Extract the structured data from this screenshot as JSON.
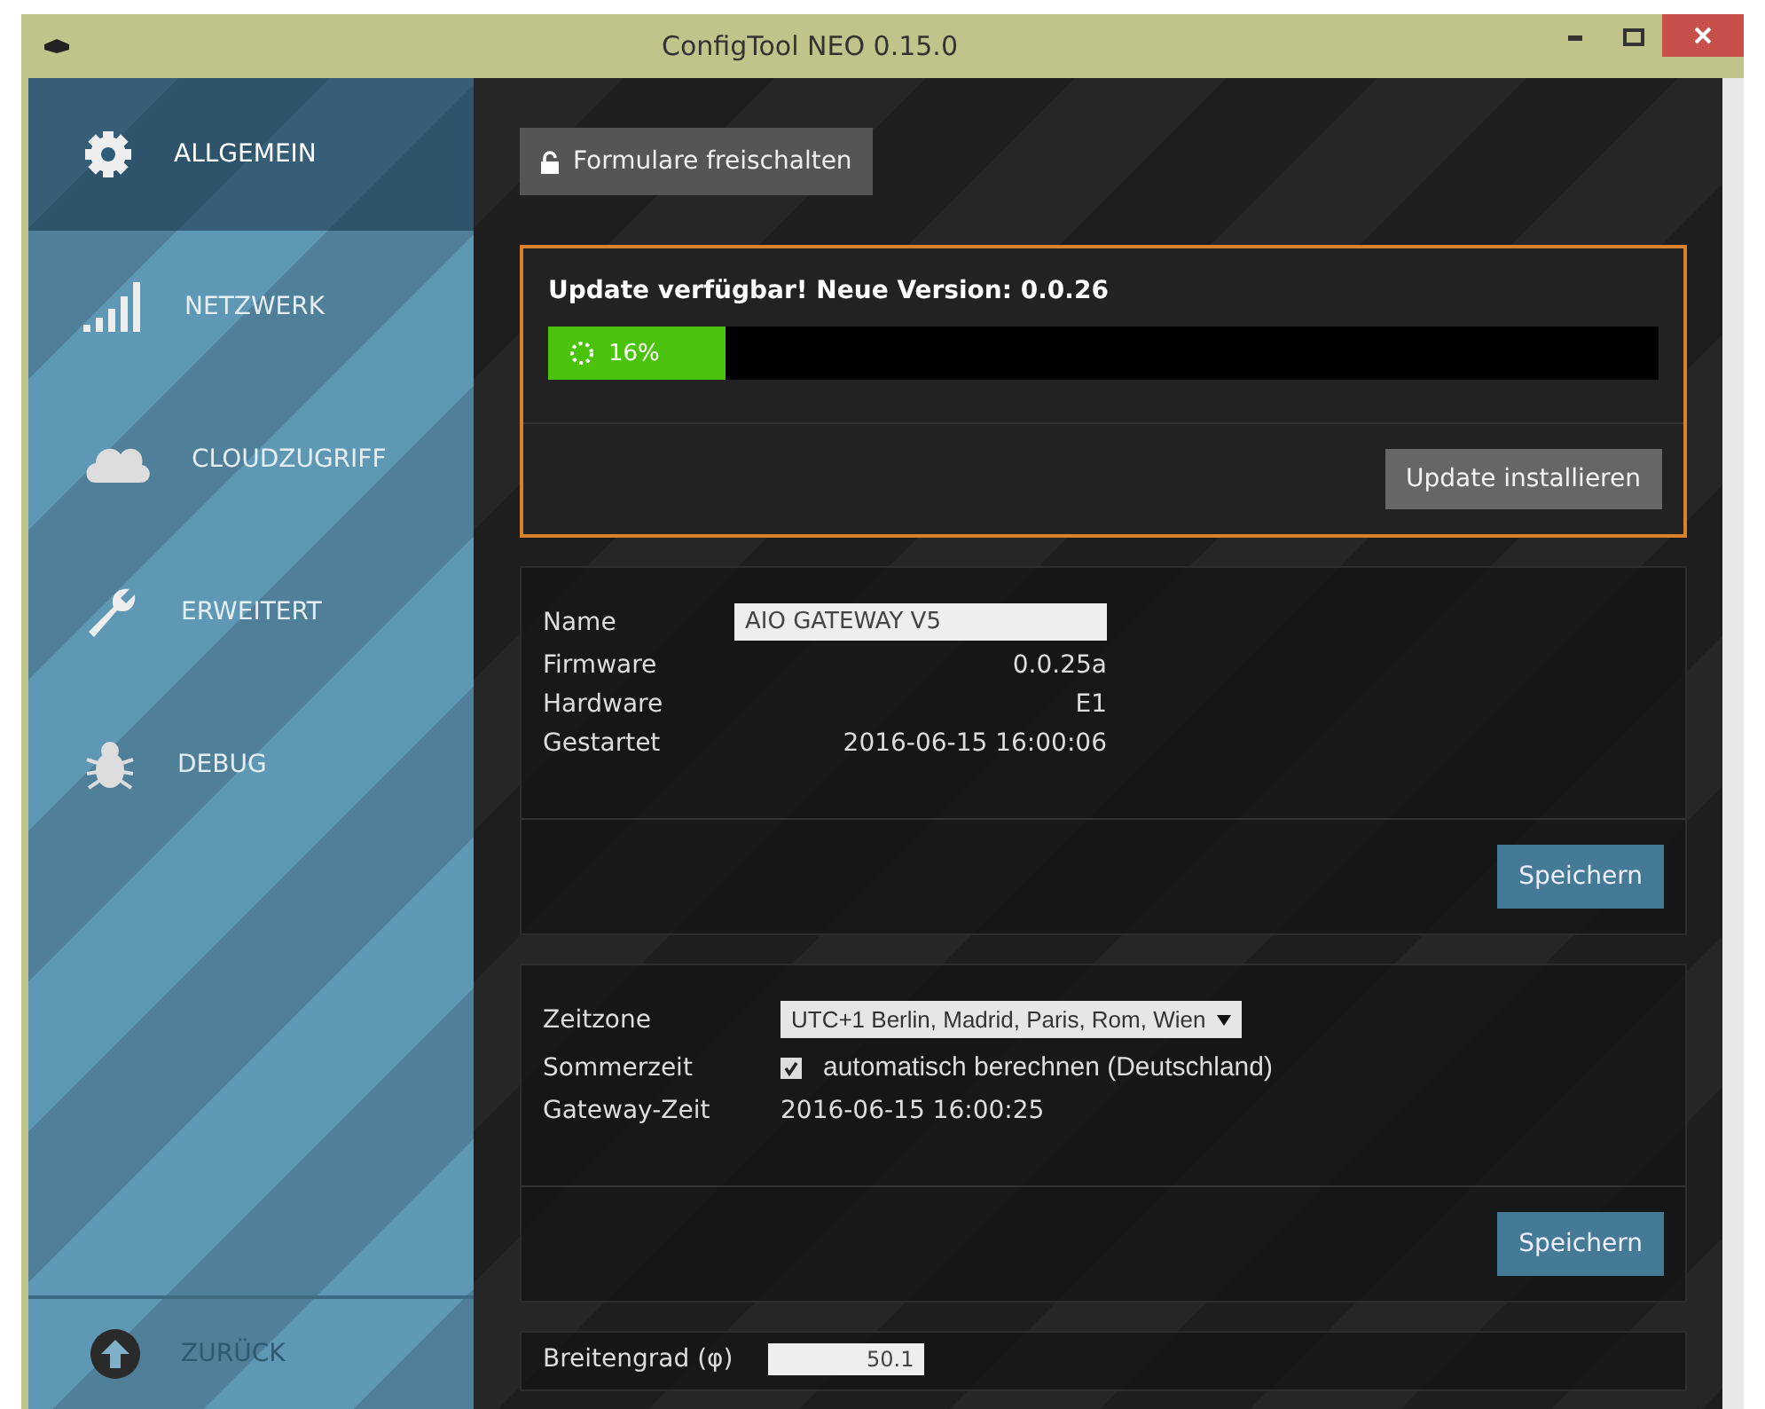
{
  "window": {
    "title": "ConfigTool NEO 0.15.0"
  },
  "sidebar": {
    "items": [
      {
        "label": "ALLGEMEIN",
        "selected": true
      },
      {
        "label": "NETZWERK",
        "selected": false
      },
      {
        "label": "CLOUDZUGRIFF",
        "selected": false
      },
      {
        "label": "ERWEITERT",
        "selected": false
      },
      {
        "label": "DEBUG",
        "selected": false
      }
    ],
    "back_button": "ZURÜCK"
  },
  "unlock_button": "Formulare freischalten",
  "update": {
    "title": "Update verfügbar! Neue Version: 0.0.26",
    "progress": {
      "level": 0.16,
      "reading": "16%"
    },
    "button": "Update installieren"
  },
  "device": {
    "rows": [
      {
        "kind": "field",
        "label": "Name",
        "value": "AIO GATEWAY V5"
      },
      {
        "kind": "text",
        "label": "Firmware",
        "value": "0.0.25a"
      },
      {
        "kind": "text",
        "label": "Hardware",
        "value": "E1"
      },
      {
        "kind": "text",
        "label": "Gestartet",
        "value": "2016-06-15 16:00:06"
      }
    ],
    "button": "Speichern"
  },
  "time": {
    "timezone": {
      "label": "Zeitzone",
      "value": "UTC+1  Berlin, Madrid, Paris, Rom, Wien"
    },
    "dst": {
      "label": "Sommerzeit",
      "checked": true,
      "text": "automatisch berechnen (Deutschland)"
    },
    "gateway_time": {
      "label": "Gateway-Zeit",
      "value": "2016-06-15 16:00:25"
    },
    "button": "Speichern"
  },
  "location": {
    "label": "Breitengrad (φ)",
    "value": "50.1"
  }
}
